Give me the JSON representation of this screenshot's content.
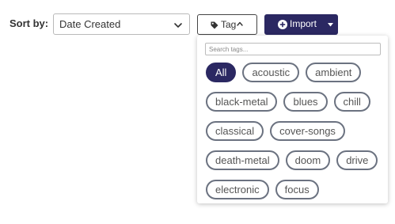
{
  "sort": {
    "label": "Sort by:",
    "selected": "Date Created"
  },
  "tag_button": {
    "label": "Tag"
  },
  "import_button": {
    "label": "Import"
  },
  "tag_dropdown": {
    "search_placeholder": "Search tags...",
    "tags": [
      {
        "label": "All",
        "active": true
      },
      {
        "label": "acoustic",
        "active": false
      },
      {
        "label": "ambient",
        "active": false
      },
      {
        "label": "black-metal",
        "active": false
      },
      {
        "label": "blues",
        "active": false
      },
      {
        "label": "chill",
        "active": false
      },
      {
        "label": "classical",
        "active": false
      },
      {
        "label": "cover-songs",
        "active": false
      },
      {
        "label": "death-metal",
        "active": false
      },
      {
        "label": "doom",
        "active": false
      },
      {
        "label": "drive",
        "active": false
      },
      {
        "label": "electronic",
        "active": false
      },
      {
        "label": "focus",
        "active": false
      }
    ]
  },
  "icons": {
    "sort_chevron": "chevron-down-icon",
    "tag": "tag-icon",
    "tag_caret": "chevron-up-icon",
    "import_plus": "plus-circle-icon",
    "import_caret": "caret-down-icon"
  },
  "colors": {
    "primary": "#2b2862",
    "pill_border": "#6b7280"
  }
}
